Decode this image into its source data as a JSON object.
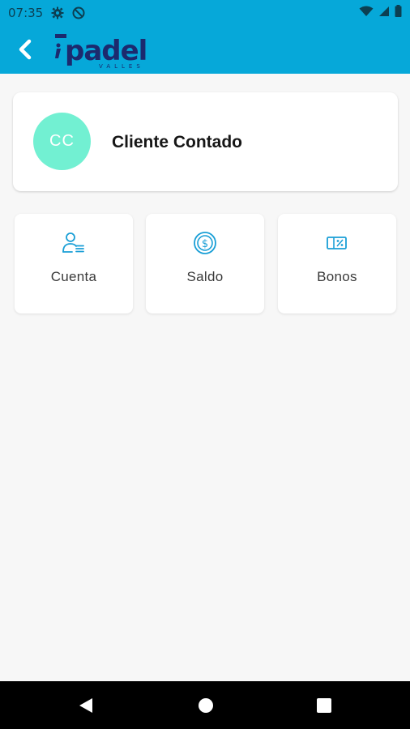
{
  "status_bar": {
    "time": "07:35",
    "icons": [
      "settings-icon",
      "at-sign-icon",
      "wifi-icon",
      "signal-icon",
      "battery-icon"
    ]
  },
  "app_bar": {
    "logo_text": "padel",
    "logo_subtext": "VALLES"
  },
  "profile": {
    "initials": "CC",
    "name": "Cliente Contado",
    "avatar_color": "#72f0d2"
  },
  "tiles": [
    {
      "label": "Cuenta",
      "icon": "user-account-icon"
    },
    {
      "label": "Saldo",
      "icon": "dollar-coin-icon"
    },
    {
      "label": "Bonos",
      "icon": "voucher-percent-icon"
    }
  ],
  "colors": {
    "primary": "#06a8d9",
    "icon_blue": "#1a9fd6",
    "background": "#f7f7f7"
  },
  "nav_bar": {
    "buttons": [
      "back-triangle-icon",
      "home-circle-icon",
      "recents-square-icon"
    ]
  }
}
